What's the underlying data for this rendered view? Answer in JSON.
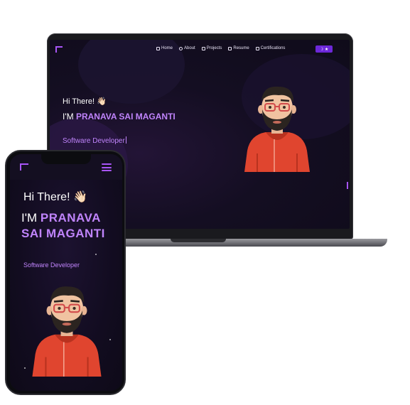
{
  "laptop": {
    "nav": {
      "items": [
        {
          "label": "Home",
          "icon": "home-icon"
        },
        {
          "label": "About",
          "icon": "user-icon"
        },
        {
          "label": "Projects",
          "icon": "folder-icon"
        },
        {
          "label": "Resume",
          "icon": "file-icon"
        },
        {
          "label": "Certifications",
          "icon": "certificate-icon"
        }
      ],
      "theme_toggle": "☽ ★"
    },
    "hero": {
      "greeting": "Hi There! 👋🏻",
      "prefix": "I'M ",
      "name": "PRANAVA SAI MAGANTI",
      "role": "Software Developer"
    }
  },
  "phone": {
    "hero": {
      "greeting": "Hi There! 👋🏻",
      "prefix": "I'M ",
      "name": "PRANAVA SAI MAGANTI",
      "role": "Software Developer"
    }
  },
  "colors": {
    "accent": "#c084fc",
    "accent_dark": "#6d28d9",
    "background": "#120c20",
    "avatar_hoodie": "#e0452f"
  }
}
